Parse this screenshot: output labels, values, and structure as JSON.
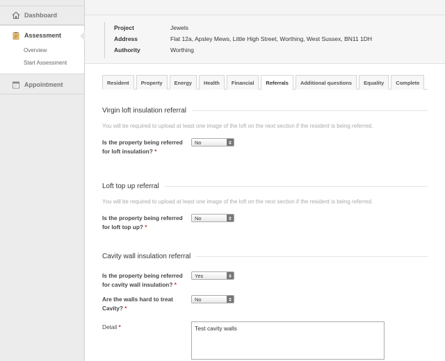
{
  "sidebar": {
    "dashboard": "Dashboard",
    "assessment": "Assessment",
    "overview": "Overview",
    "start_assessment": "Start Assessment",
    "appointment": "Appointment"
  },
  "info": {
    "project_label": "Project",
    "project_value": "Jewels",
    "address_label": "Address",
    "address_value": "Flat 12a, Apsley Mews, Little High Street, Worthing, West Sussex, BN11 1DH",
    "authority_label": "Authority",
    "authority_value": "Worthing"
  },
  "tabs": [
    "Resident",
    "Property",
    "Energy",
    "Health",
    "Financial",
    "Referrals",
    "Additional questions",
    "Equality",
    "Complete"
  ],
  "active_tab": "Referrals",
  "sections": {
    "virgin_loft": {
      "title": "Virgin loft insulation referral",
      "hint": "You will be required to upload at least one image of the loft on the next section if the resident is being referred.",
      "q_line1": "Is the property being referred",
      "q_line2": "for loft insulation?",
      "value": "No"
    },
    "loft_topup": {
      "title": "Loft top up referral",
      "hint": "You will be required to upload at least one image of the loft on the next section if the resident is being referred.",
      "q_line1": "Is the property being referred",
      "q_line2": "for loft top up?",
      "value": "No"
    },
    "cavity": {
      "title": "Cavity wall insulation referral",
      "q1_line1": "Is the property being referred",
      "q1_line2": "for cavity wall insulation?",
      "q1_value": "Yes",
      "q2_line1": "Are the walls hard to treat",
      "q2_line2": "Cavity?",
      "q2_value": "No",
      "detail_label": "Detail",
      "detail_value": "Test cavity walls"
    }
  },
  "required_mark": "*"
}
